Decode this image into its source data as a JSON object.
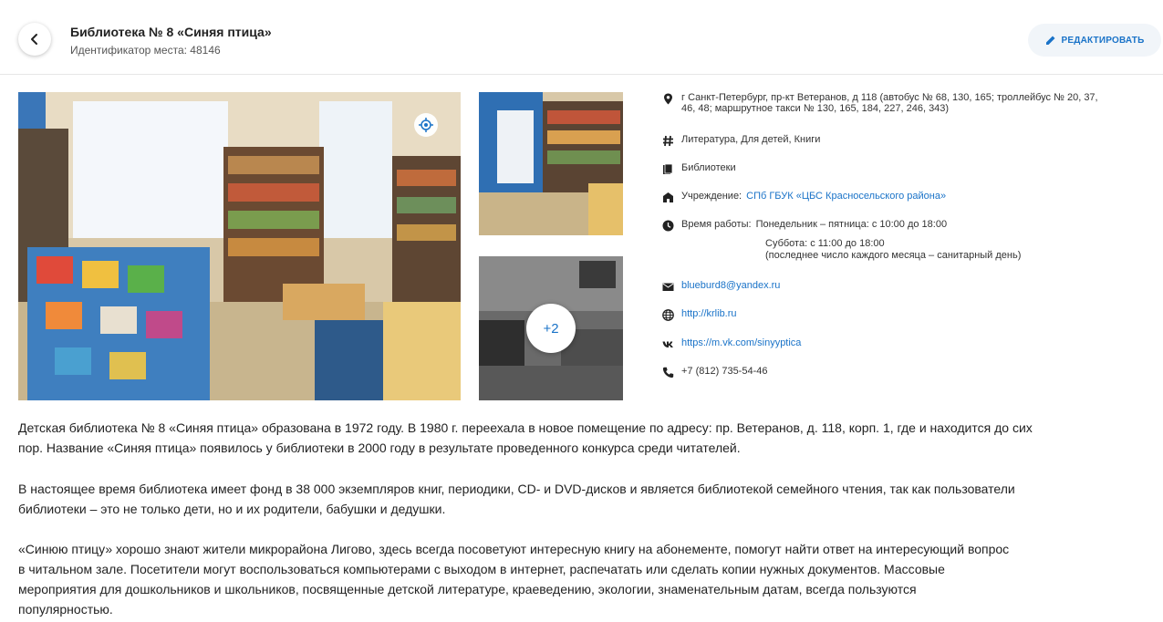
{
  "header": {
    "title": "Библиотека № 8 «Синяя птица»",
    "place_id": "Идентификатор места: 48146",
    "edit_label": "РЕДАКТИРОВАТЬ",
    "back_icon": "chevron-left-icon"
  },
  "gallery": {
    "more_count": "+2"
  },
  "info": {
    "address_line1": "г Санкт-Петербург, пр-кт Ветеранов, д 118 (автобус № 68, 130, 165; троллейбус № 20, 37,",
    "address_line2": "46, 48; маршрутное такси № 130, 165, 184, 227, 246, 343)",
    "tags": "Литература, Для детей, Книги",
    "category": "Библиотеки",
    "institution_label": "Учреждение:",
    "institution_link": "СПб ГБУК «ЦБС Красносельского района»",
    "hours_label": "Время работы:",
    "hours_line1": "Понедельник – пятница: с 10:00 до 18:00",
    "hours_line2": "Суббота: с 11:00 до 18:00",
    "hours_line3": "(последнее число каждого месяца – санитарный день)",
    "email": "blueburd8@yandex.ru",
    "website": "http://krlib.ru",
    "vk": "https://m.vk.com/sinyyptica",
    "phone": "+7 (812) 735-54-46"
  },
  "description": {
    "p1_line1": "Детская библиотека № 8 «Синяя птица» образована в 1972 году. В 1980 г. переехала в новое помещение по адресу: пр. Ветеранов, д. 118, корп. 1, где и находится до сих",
    "p1_line2": "пор. Название «Синяя птица» появилось у библиотеки в 2000 году в результате проведенного конкурса среди читателей.",
    "p2_line1": "В настоящее время библиотека имеет фонд в 38 000 экземпляров книг, периодики, CD- и DVD-дисков и является библиотекой семейного чтения, так как пользователи",
    "p2_line2": "библиотеки – это не только дети, но и их родители, бабушки и дедушки.",
    "p3_line1": "«Синюю птицу» хорошо знают жители микрорайона Лигово, здесь всегда посоветуют интересную книгу на абонементе, помогут найти ответ на интересующий вопрос",
    "p3_line2": "в читальном зале. Посетители могут воспользоваться компьютерами с выходом в интернет, распечатать или сделать копии нужных документов. Массовые",
    "p3_line3": "мероприятия для дошкольников и школьников, посвященные детской литературе, краеведению, экологии, знаменательным датам, всегда пользуются",
    "p3_line4": "популярностью."
  },
  "colors": {
    "accent": "#1a73c8",
    "edit_bg": "#f1f5f9"
  }
}
